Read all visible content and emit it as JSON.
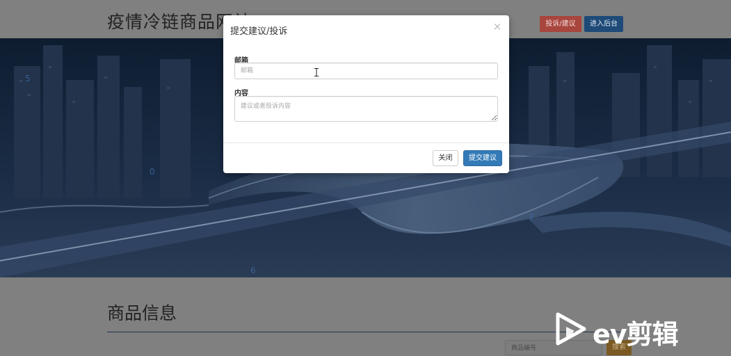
{
  "site": {
    "title": "疫情冷链商品网站",
    "complaint_button": "投诉/建议",
    "admin_button": "进入后台"
  },
  "section": {
    "title": "商品信息",
    "search_placeholder": "商品编号",
    "search_button": "搜索"
  },
  "modal": {
    "title": "提交建议/投诉",
    "close_symbol": "×",
    "email_label": "邮箱",
    "email_placeholder": "邮箱",
    "content_label": "内容",
    "content_placeholder": "建议或者投诉内容",
    "close_button": "关闭",
    "submit_button": "提交建议"
  },
  "watermark": {
    "text": "ev剪辑"
  },
  "colors": {
    "overlay": "#808080",
    "complaint_button": "#d9534f",
    "admin_button": "#337ab7",
    "submit_button": "#337ab7",
    "search_button": "#f0ad4e"
  }
}
